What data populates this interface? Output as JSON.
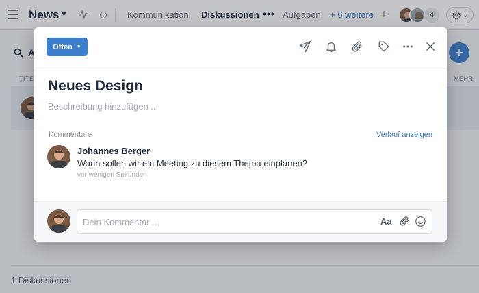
{
  "app": {
    "title": "News",
    "tabs": [
      {
        "label": "Kommunikation"
      },
      {
        "label": "Diskussionen"
      },
      {
        "label": "Aufgaben"
      },
      {
        "label": "+ 6 weitere"
      }
    ],
    "members_count": "4"
  },
  "background": {
    "search_letter": "A",
    "col_left": "TITEL",
    "col_right": "MEHR",
    "footer_count": "1 Diskussionen"
  },
  "modal": {
    "status_label": "Offen",
    "title": "Neues Design",
    "description_placeholder": "Beschreibung hinzufügen ...",
    "comments_label": "Kommentare",
    "history_link": "Verlauf anzeigen",
    "comment": {
      "author": "Johannes Berger",
      "text": "Wann sollen wir ein Meeting zu diesem Thema einplanen?",
      "time": "vor wenigen Sekunden"
    },
    "compose": {
      "placeholder": "Dein Kommentar ...",
      "format_label": "Aa"
    }
  },
  "colors": {
    "accent": "#3e7fcd",
    "link": "#3d7bc6"
  },
  "icons": [
    "menu-icon",
    "activity-icon",
    "circle-icon",
    "more-dots-icon",
    "plus-icon",
    "gear-icon",
    "search-icon",
    "send-icon",
    "bell-icon",
    "paperclip-icon",
    "tag-icon",
    "more-icon",
    "close-icon",
    "emoji-icon"
  ]
}
